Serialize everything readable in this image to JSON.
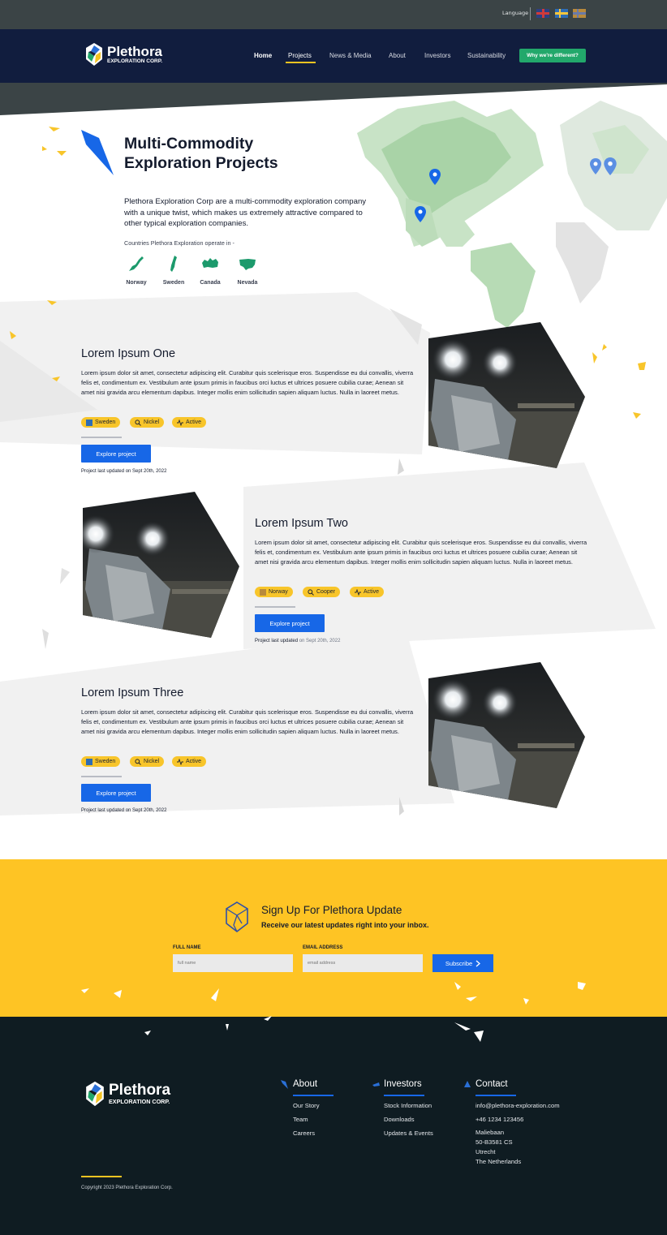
{
  "topbar": {
    "language_label": "Language",
    "flags": [
      "uk-flag-icon",
      "sweden-flag-icon",
      "norway-flag-icon"
    ]
  },
  "nav": {
    "brand": "Plethora",
    "brand_sub": "EXPLORATION CORP.",
    "items": [
      "Home",
      "Projects",
      "News & Media",
      "About",
      "Investors",
      "Sustainability"
    ],
    "active": "Projects",
    "cta": "Why we're different?"
  },
  "hero": {
    "title": "Multi-Commodity Exploration Projects",
    "description": "Plethora Exploration Corp are a multi-commodity exploration company with a unique twist, which makes us extremely attractive compared to other typical exploration companies.",
    "countries_label": "Countries Plethora Exploration operate in -",
    "countries": [
      "Norway",
      "Sweden",
      "Canada",
      "Nevada"
    ]
  },
  "projects": [
    {
      "title": "Lorem Ipsum One",
      "description": "Lorem ipsum dolor sit amet, consectetur adipiscing elit. Curabitur quis scelerisque eros. Suspendisse eu dui convallis, viverra felis et, condimentum ex. Vestibulum ante ipsum primis in faucibus orci luctus et ultrices posuere cubilia curae; Aenean sit amet nisi gravida arcu elementum dapibus. Integer mollis enim sollicitudin sapien aliquam luctus. Nulla in laoreet metus.",
      "tags": [
        "Sweden",
        "Nickel",
        "Active"
      ],
      "button": "Explore project",
      "updated_prefix": "Project last updated on",
      "updated_date": "Sept 20th, 2022"
    },
    {
      "title": "Lorem Ipsum Two",
      "description": "Lorem ipsum dolor sit amet, consectetur adipiscing elit. Curabitur quis scelerisque eros. Suspendisse eu dui convallis, viverra felis et, condimentum ex. Vestibulum ante ipsum primis in faucibus orci luctus et ultrices posuere cubilia curae; Aenean sit amet nisi gravida arcu elementum dapibus. Integer mollis enim sollicitudin sapien aliquam luctus. Nulla in laoreet metus.",
      "tags": [
        "Norway",
        "Cooper",
        "Active"
      ],
      "button": "Explore project",
      "updated_prefix": "Project last updated",
      "updated_date": "on Sept 20th, 2022"
    },
    {
      "title": "Lorem Ipsum Three",
      "description": "Lorem ipsum dolor sit amet, consectetur adipiscing elit. Curabitur quis scelerisque eros. Suspendisse eu dui convallis, viverra felis et, condimentum ex. Vestibulum ante ipsum primis in faucibus orci luctus et ultrices posuere cubilia curae; Aenean sit amet nisi gravida arcu elementum dapibus. Integer mollis enim sollicitudin sapien aliquam luctus. Nulla in laoreet metus.",
      "tags": [
        "Sweden",
        "Nickel",
        "Active"
      ],
      "button": "Explore project",
      "updated_prefix": "Project last updated on",
      "updated_date": "Sept 20th, 2022"
    }
  ],
  "signup": {
    "title": "Sign Up For Plethora Update",
    "subtitle": "Receive our latest updates right into your inbox.",
    "name_label": "FULL NAME",
    "name_placeholder": "full name",
    "email_label": "EMAIL ADDRESS",
    "email_placeholder": "email address",
    "button": "Subscribe"
  },
  "footer": {
    "brand": "Plethora",
    "brand_sub": "EXPLORATION CORP.",
    "about": {
      "title": "About",
      "links": [
        "Our Story",
        "Team",
        "Careers"
      ]
    },
    "investors": {
      "title": "Investors",
      "links": [
        "Stock Information",
        "Downloads",
        "Updates & Events"
      ]
    },
    "contact": {
      "title": "Contact",
      "email": "info@plethora-exploration.com",
      "phone": "+46 1234 123456",
      "address": "Maliebaan\n50-B3581 CS\nUtrecht\nThe Netherlands"
    },
    "copyright": "Copyright 2023 Plethora Exploration Corp."
  },
  "colors": {
    "navy": "#111d3e",
    "accent_yellow": "#fec424",
    "button_blue": "#1767e7",
    "cta_green": "#22a86b",
    "footer_bg": "#0f1c22"
  }
}
